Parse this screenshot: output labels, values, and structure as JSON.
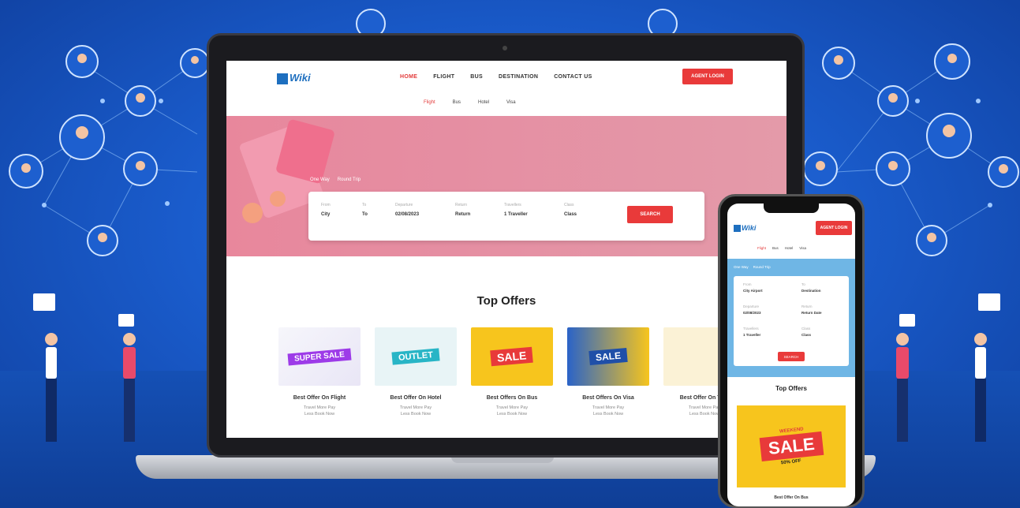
{
  "colors": {
    "background": "#1c5fd0",
    "accent": "#e93a3a",
    "brand": "#1e6fbf"
  },
  "laptop": {
    "header": {
      "logo_text": "Wiki",
      "nav": [
        "HOME",
        "FLIGHT",
        "BUS",
        "DESTINATION",
        "CONTACT US"
      ],
      "agent_button": "AGENT LOGIN",
      "tabs": [
        "Flight",
        "Bus",
        "Hotel",
        "Visa"
      ]
    },
    "hero": {
      "trip_options": [
        "One Way",
        "Round Trip"
      ],
      "fields": [
        {
          "label": "From",
          "value": "City"
        },
        {
          "label": "To",
          "value": "To"
        },
        {
          "label": "Departure",
          "value": "02/08/2023"
        },
        {
          "label": "Return",
          "value": "Return"
        },
        {
          "label": "Travellers",
          "value": "1 Traveller"
        },
        {
          "label": "Class",
          "value": "Class"
        }
      ],
      "search_button": "SEARCH"
    },
    "offers": {
      "title": "Top Offers",
      "cards": [
        {
          "banner": "SUPER SALE",
          "title": "Best Offer On Flight",
          "desc1": "Travel More Pay",
          "desc2": "Less Book Now"
        },
        {
          "banner": "OUTLET",
          "title": "Best Offer On Hotel",
          "desc1": "Travel More Pay",
          "desc2": "Less Book Now"
        },
        {
          "banner": "SALE",
          "title": "Best Offers On Bus",
          "desc1": "Travel More Pay",
          "desc2": "Less Book Now"
        },
        {
          "banner": "SALE",
          "title": "Best Offers On Visa",
          "desc1": "Travel More Pay",
          "desc2": "Less Book Now"
        },
        {
          "banner": "",
          "title": "Best Offer On Tour",
          "desc1": "Travel More Pay",
          "desc2": "Less Book Now"
        }
      ]
    }
  },
  "phone": {
    "logo_text": "Wiki",
    "agent_button": "AGENT LOGIN",
    "tabs": [
      "Flight",
      "Bus",
      "Hotel",
      "Visa"
    ],
    "trip_options": [
      "One Way",
      "Round Trip"
    ],
    "fields": [
      {
        "label": "From",
        "value": "City Airport"
      },
      {
        "label": "To",
        "value": "Destination"
      },
      {
        "label": "Departure",
        "value": "02/08/2023"
      },
      {
        "label": "Return",
        "value": "Return Date"
      },
      {
        "label": "Travellers",
        "value": "1 Traveller"
      },
      {
        "label": "Class",
        "value": "Class"
      }
    ],
    "search_button": "SEARCH",
    "offers_title": "Top Offers",
    "banner": {
      "top": "WEEKEND",
      "main": "SALE",
      "bottom": "50% OFF"
    },
    "card_title": "Best Offer On Bus"
  }
}
